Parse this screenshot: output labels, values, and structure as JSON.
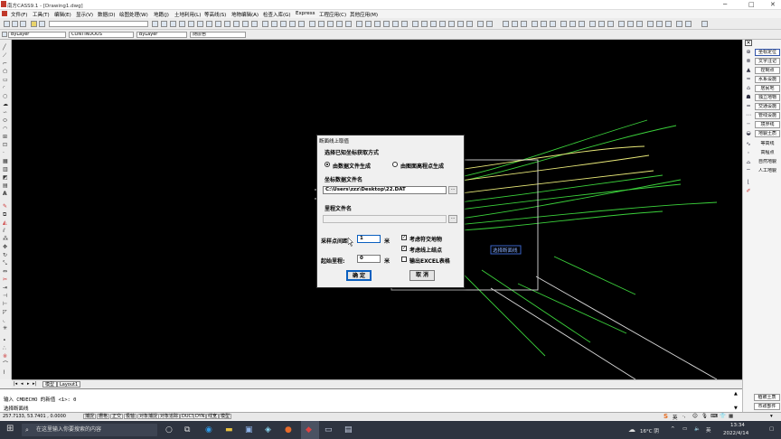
{
  "window": {
    "title": "南方CASS9.1 - [Drawing1.dwg]",
    "controls": [
      "─",
      "□",
      "✕"
    ]
  },
  "menu": [
    "文件(F)",
    "工具(T)",
    "编辑(E)",
    "显示(V)",
    "数据(D)",
    "绘图处理(W)",
    "地籍(J)",
    "土地利用(L)",
    "等高线(S)",
    "地物编辑(A)",
    "检查入库(G)",
    "Express",
    "工程应用(C)",
    "其他应用(M)"
  ],
  "properties": {
    "layer": "ByLayer",
    "linetype": "CONTINUOUS",
    "lineweight": "ByLayer",
    "color": "随层色"
  },
  "right_panel": {
    "buttons": [
      "坐标定位",
      "文字注记",
      "控制点",
      "水系设施",
      "居民地",
      "独立地物",
      "交通设施",
      "管线设施",
      "境界线",
      "地貌土质",
      "等高线",
      "高程点",
      "自然地貌",
      "人工地貌"
    ],
    "selected": "坐标定位",
    "bottom": [
      "植被土质",
      "市政部件"
    ]
  },
  "canvas": {
    "overlay_label": "选择断面线",
    "colors": {
      "green": "#3bd13b",
      "yellow": "#e8e878",
      "white": "#d8d8d8",
      "blue": "#3a63c8"
    }
  },
  "dialog": {
    "title": "断面线上取值",
    "section_method": "选择已知坐标获取方式",
    "radio_datafile": "由数据文件生成",
    "radio_grid": "由图面高程点生成",
    "coordfile_label": "坐标数据文件名",
    "coordfile_value": "C:\\Users\\zzz\\Desktop\\22.DAT",
    "browse": "...",
    "chainage_label": "里程文件名",
    "chainage_value": "",
    "interval_label": "采样点间距:",
    "interval_value": "1",
    "unit": "米",
    "start_label": "起始里程:",
    "start_value": "0",
    "chk_intersect": "考虑符交地物",
    "chk_onpoint": "考虑线上结点",
    "chk_excel": "输出EXCEL表格",
    "chk_intersect_on": true,
    "chk_onpoint_on": true,
    "chk_excel_on": false,
    "ok": "确 定",
    "cancel": "取 消"
  },
  "tabs": {
    "model": "模型",
    "layout": "Layout1"
  },
  "command": {
    "line1": "输入 CMDECHO 的新值 <1>: 0",
    "line2": "选择断面线"
  },
  "status": {
    "coords": "257.7133, 53.7401 , 0.0000",
    "toggles": [
      "捕捉",
      "栅格",
      "正交",
      "极轴",
      "对象捕捉",
      "对象追踪",
      "DUCS",
      "DYN",
      "线宽",
      "模型"
    ]
  },
  "taskbar": {
    "search_placeholder": "在这里输入你要搜索的内容",
    "weather": "16°C 阴",
    "time": "13:34",
    "date": "2022/4/14"
  }
}
